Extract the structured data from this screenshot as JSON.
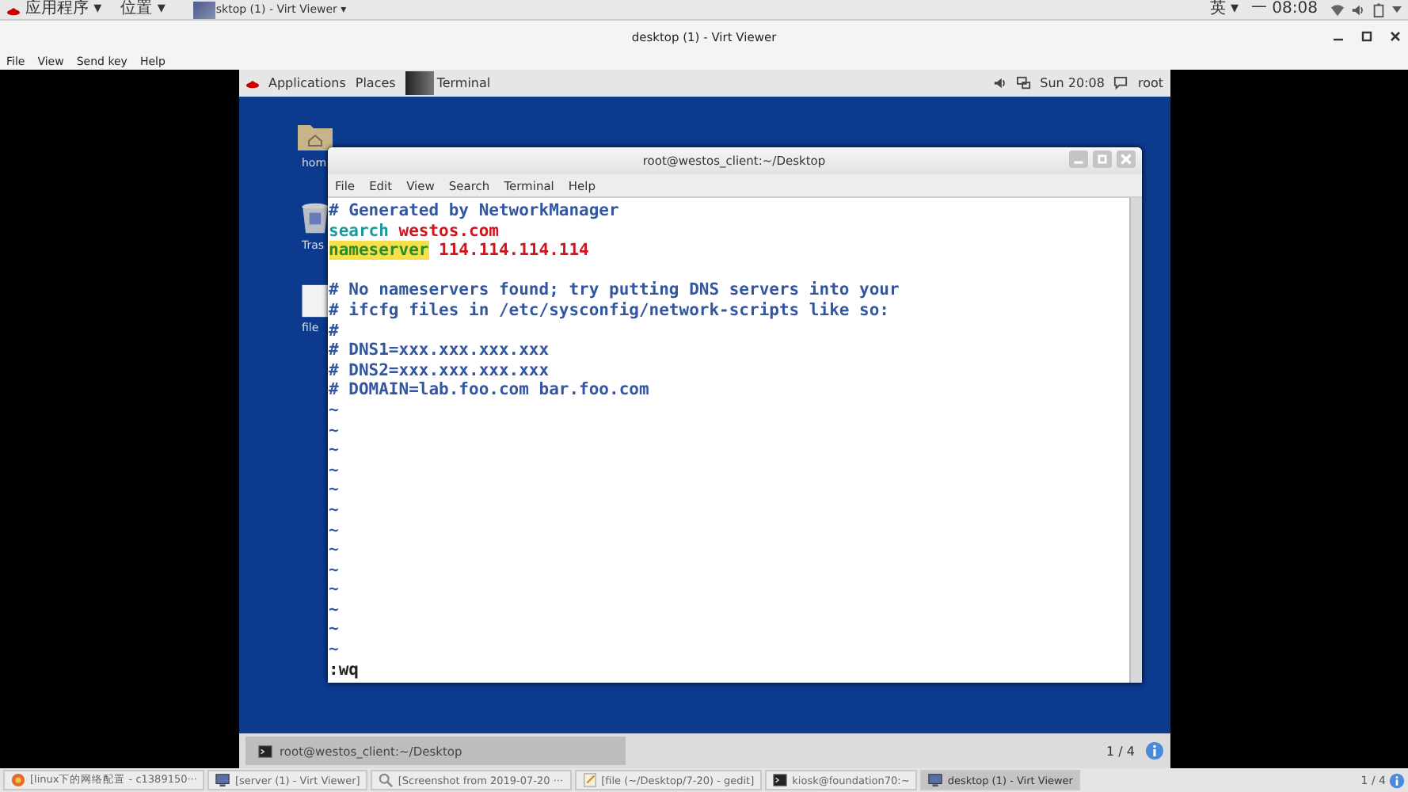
{
  "host_top_bar": {
    "menus": [
      {
        "label": "应用程序 ▾",
        "kind": "redhat"
      },
      {
        "label": "位置 ▾",
        "kind": "plain"
      }
    ],
    "window_button": "sktop (1) - Virt Viewer ▾",
    "status": [
      "英 ▾",
      "一 08:08"
    ]
  },
  "viewer": {
    "title": "desktop (1) - Virt Viewer",
    "menu": [
      "File",
      "View",
      "Send key",
      "Help"
    ]
  },
  "guest_top_bar": {
    "menus": [
      "Applications",
      "Places"
    ],
    "task": "Terminal",
    "clock": "Sun 20:08",
    "user": "root"
  },
  "desktop_icons": [
    {
      "label": "hom",
      "kind": "folder"
    },
    {
      "label": "Tras",
      "kind": "trash"
    },
    {
      "label": "file",
      "kind": "file"
    }
  ],
  "terminal": {
    "title": "root@westos_client:~/Desktop",
    "menu": [
      "File",
      "Edit",
      "View",
      "Search",
      "Terminal",
      "Help"
    ],
    "lines": [
      [
        {
          "text": "# Generated by NetworkManager",
          "kind": "comment"
        }
      ],
      [
        {
          "text": "search",
          "kind": "keyword"
        },
        {
          "text": " westos.com",
          "kind": "value"
        }
      ],
      [
        {
          "text": "nameserver",
          "kind": "match"
        },
        {
          "text": " 114.114.114.114",
          "kind": "value"
        }
      ],
      {
        "kind": "blank"
      },
      [
        {
          "text": "# No nameservers found; try putting DNS servers into your",
          "kind": "comment"
        }
      ],
      [
        {
          "text": "# ifcfg files in /etc/sysconfig/network-scripts like so:",
          "kind": "comment"
        }
      ],
      [
        {
          "text": "#",
          "kind": "comment"
        }
      ],
      [
        {
          "text": "# DNS1=xxx.xxx.xxx.xxx",
          "kind": "comment"
        }
      ],
      [
        {
          "text": "# DNS2=xxx.xxx.xxx.xxx",
          "kind": "comment"
        }
      ],
      [
        {
          "text": "# DOMAIN=lab.foo.com bar.foo.com",
          "kind": "comment"
        }
      ]
    ],
    "tildes": [
      "~",
      "~",
      "~",
      "~",
      "~",
      "~",
      "~",
      "~",
      "~",
      "~",
      "~",
      "~",
      "~"
    ],
    "command": ":wq"
  },
  "guest_taskbar": {
    "task": "root@westos_client:~/Desktop",
    "pager": "1 / 4"
  },
  "host_taskbar": {
    "items": [
      {
        "label": "[linux下的网络配置 - c1389150···",
        "kind": "browser",
        "selected": false
      },
      {
        "label": "[server (1) - Virt Viewer]",
        "kind": "viewer",
        "selected": false
      },
      {
        "label": "[Screenshot from 2019-07-20 ···",
        "kind": "search",
        "selected": false
      },
      {
        "label": "[file (~/Desktop/7-20) - gedit]",
        "kind": "editor",
        "selected": false
      },
      {
        "label": "kiosk@foundation70:~",
        "kind": "terminal",
        "selected": false
      },
      {
        "label": "desktop (1) - Virt Viewer",
        "kind": "viewer",
        "selected": true
      }
    ],
    "pager": "1 / 4"
  }
}
